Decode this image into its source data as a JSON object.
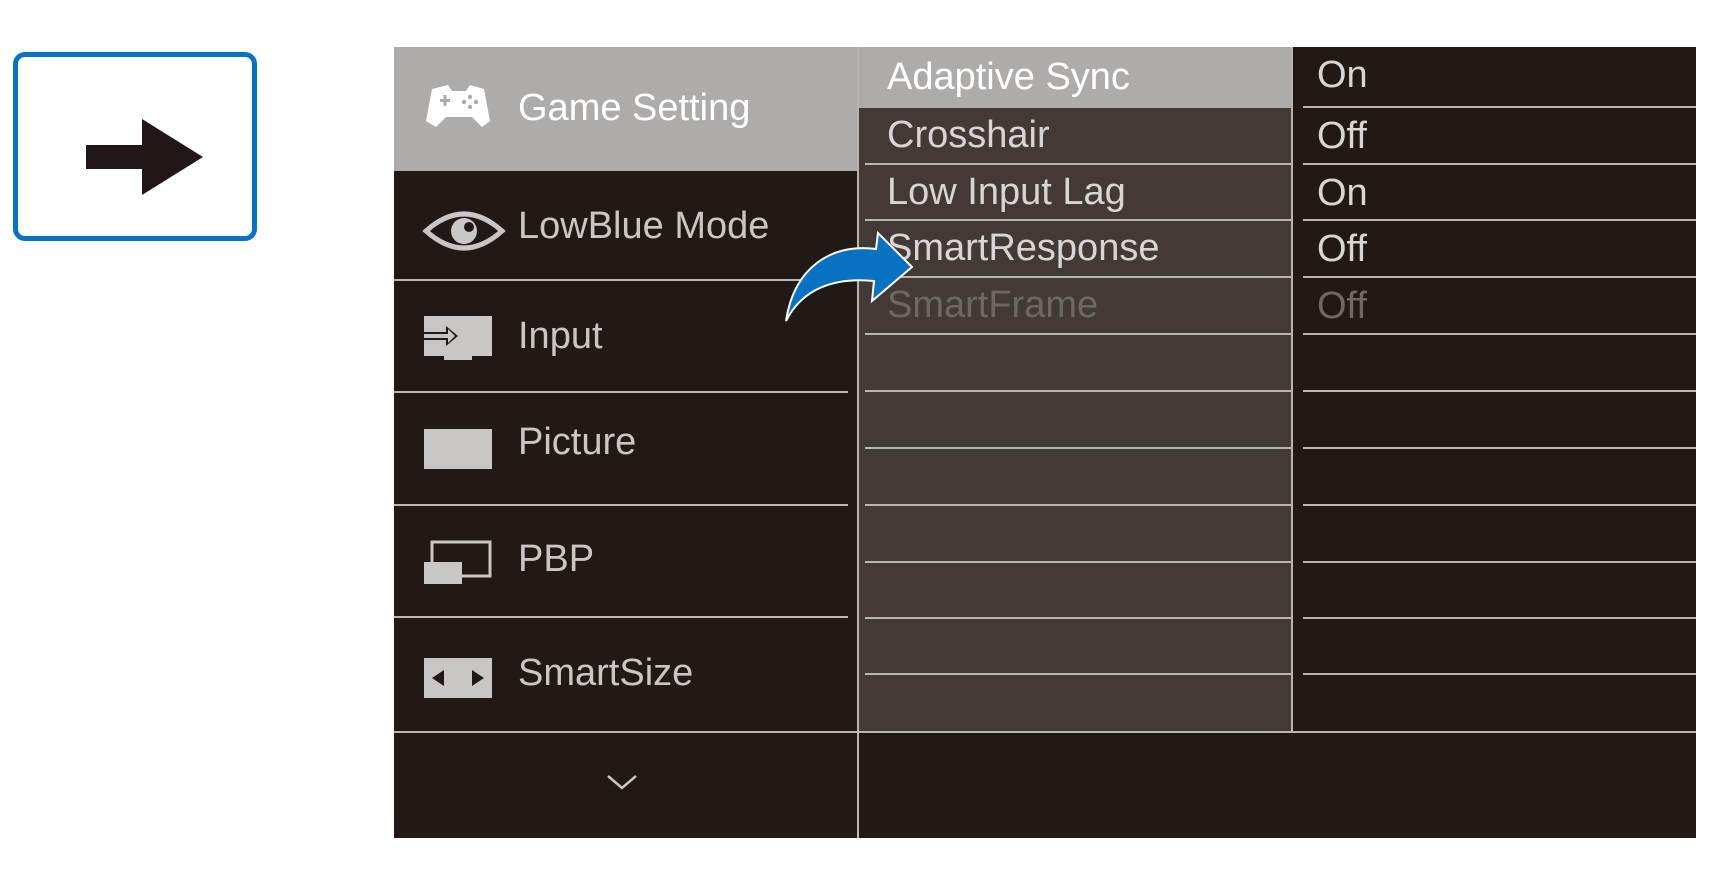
{
  "key_button": {
    "icon": "right-arrow-icon",
    "border_color": "#0a72c3"
  },
  "main_menu": {
    "items": [
      {
        "label": "Game Setting",
        "icon": "gamepad-icon",
        "active": true
      },
      {
        "label": "LowBlue Mode",
        "icon": "eye-icon",
        "active": false
      },
      {
        "label": "Input",
        "icon": "input-icon",
        "active": false
      },
      {
        "label": "Picture",
        "icon": "picture-icon",
        "active": false
      },
      {
        "label": "PBP",
        "icon": "pbp-icon",
        "active": false
      },
      {
        "label": "SmartSize",
        "icon": "smartsize-icon",
        "active": false
      }
    ],
    "more_icon": "chevron-down-icon"
  },
  "submenu": {
    "items": [
      {
        "label": "Adaptive Sync",
        "active": true
      },
      {
        "label": "Crosshair"
      },
      {
        "label": "Low Input Lag"
      },
      {
        "label": "SmartResponse"
      },
      {
        "label": "SmartFrame",
        "disabled": true
      }
    ]
  },
  "values": {
    "items": [
      {
        "label": "On"
      },
      {
        "label": "Off"
      },
      {
        "label": "On"
      },
      {
        "label": "Off"
      },
      {
        "label": "Off",
        "disabled": true
      }
    ]
  },
  "colors": {
    "panel_bg": "#211915",
    "submenu_bg": "#433a38",
    "highlight": "#aeacab",
    "accent_blue": "#0a72c3"
  }
}
